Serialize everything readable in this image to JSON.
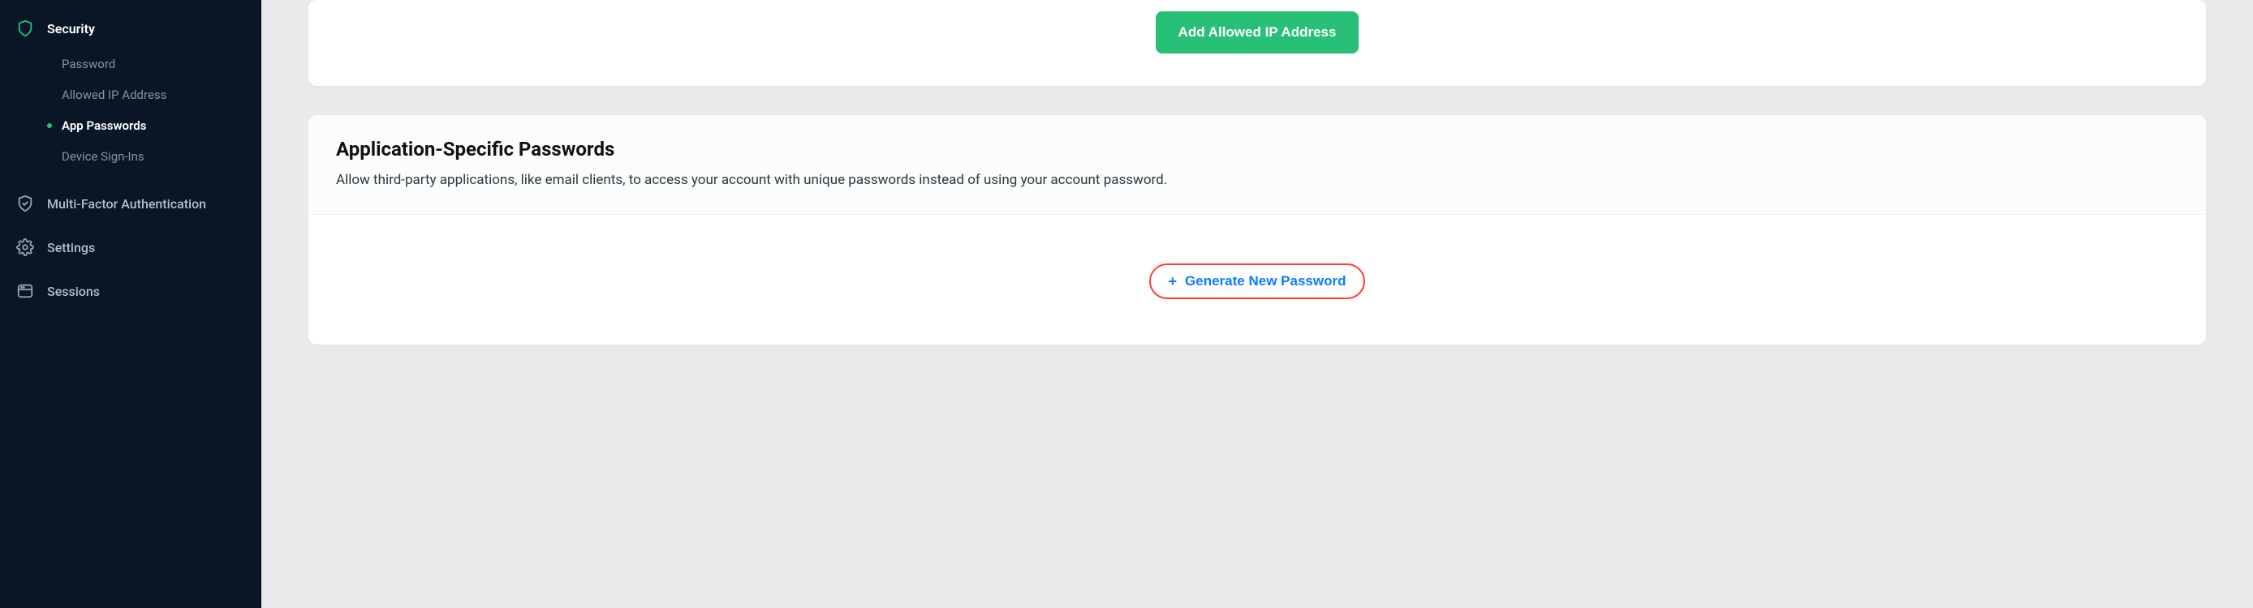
{
  "sidebar": {
    "security": {
      "label": "Security",
      "items": [
        {
          "label": "Password",
          "active": false
        },
        {
          "label": "Allowed IP Address",
          "active": false
        },
        {
          "label": "App Passwords",
          "active": true
        },
        {
          "label": "Device Sign-Ins",
          "active": false
        }
      ]
    },
    "mfa": {
      "label": "Multi-Factor Authentication"
    },
    "settings": {
      "label": "Settings"
    },
    "sessions": {
      "label": "Sessions"
    }
  },
  "ip_card": {
    "button_label": "Add Allowed IP Address"
  },
  "app_card": {
    "title": "Application-Specific Passwords",
    "description": "Allow third-party applications, like email clients, to access your account with unique passwords instead of using your account password.",
    "generate_label": "Generate New Password"
  },
  "colors": {
    "accent_green": "#27c076",
    "accent_blue": "#0a7cff",
    "highlight_red": "#ff3b30",
    "sidebar_bg": "#0a1626"
  }
}
